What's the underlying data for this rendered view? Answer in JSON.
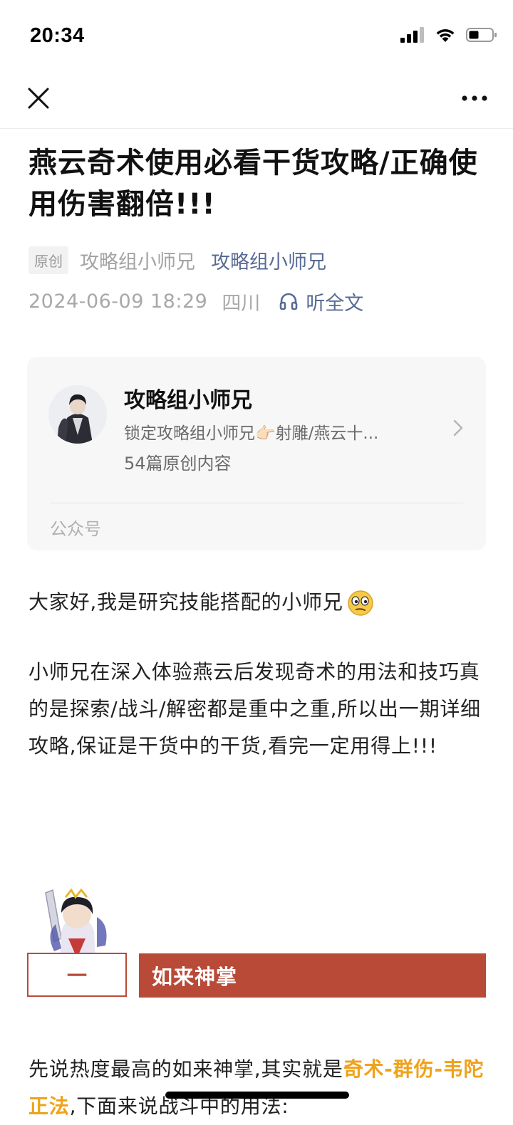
{
  "status_bar": {
    "time": "20:34"
  },
  "nav": {
    "close_icon": "close-icon",
    "more_icon": "more-horizontal-icon"
  },
  "article": {
    "title": "燕云奇术使用必看干货攻略/正确使用伤害翻倍!!!",
    "original_tag": "原创",
    "author_plain": "攻略组小师兄",
    "author_link": "攻略组小师兄",
    "datetime": "2024-06-09 18:29",
    "region": "四川",
    "listen_label": "听全文"
  },
  "account_card": {
    "name": "攻略组小师兄",
    "description": "锁定攻略组小师兄👉🏻射雕/燕云十...",
    "count_text": "54篇原创内容",
    "type_label": "公众号"
  },
  "body": {
    "p1": "大家好,我是研究技能搭配的小师兄",
    "p2": "小师兄在深入体验燕云后发现奇术的用法和技巧真的是探索/战斗/解密都是重中之重,所以出一期详细攻略,保证是干货中的干货,看完一定用得上!!!",
    "section_number": "一",
    "section_title": "如来神掌",
    "p3_prefix": "先说热度最高的如来神掌,其实就是",
    "p3_highlight": "奇术-群伤-韦陀正法",
    "p3_suffix": ",下面来说战斗中的用法:"
  },
  "colors": {
    "link": "#576b95",
    "section_red": "#b94a38",
    "highlight_orange": "#f0a21a"
  }
}
